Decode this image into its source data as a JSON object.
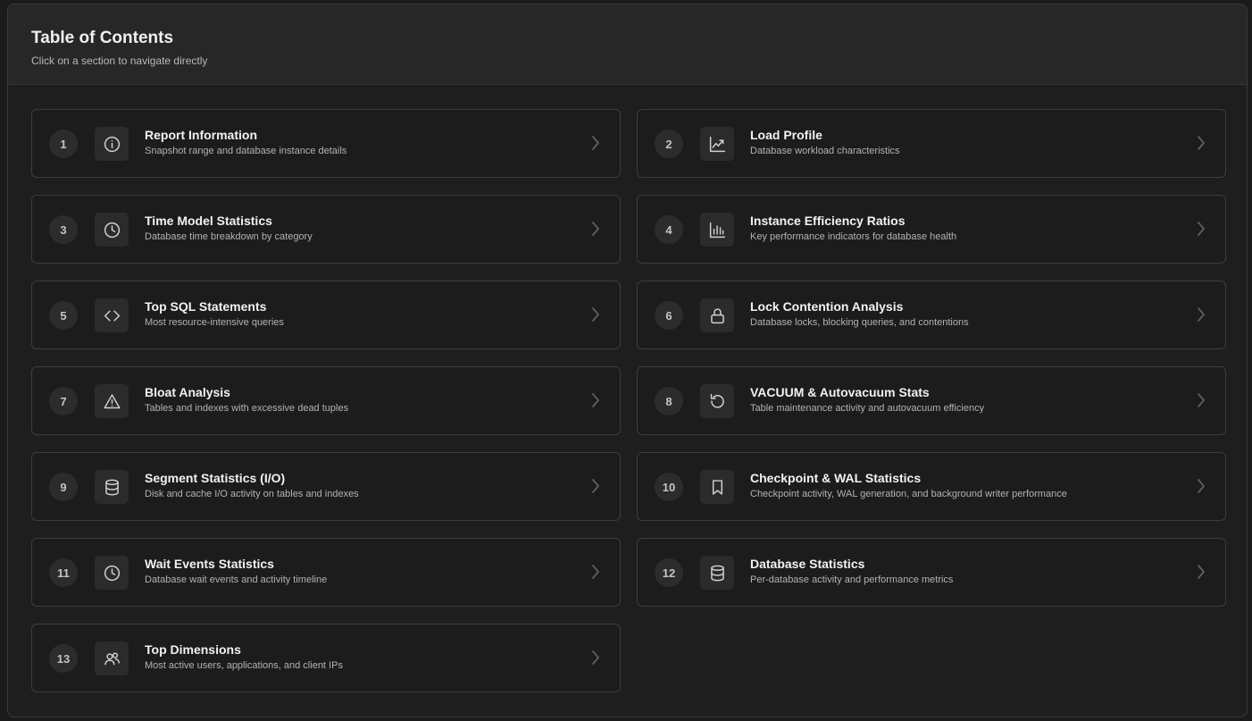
{
  "header": {
    "title": "Table of Contents",
    "subtitle": "Click on a section to navigate directly"
  },
  "sections": [
    {
      "number": "1",
      "title": "Report Information",
      "description": "Snapshot range and database instance details",
      "icon": "info-icon"
    },
    {
      "number": "2",
      "title": "Load Profile",
      "description": "Database workload characteristics",
      "icon": "trend-chart-icon"
    },
    {
      "number": "3",
      "title": "Time Model Statistics",
      "description": "Database time breakdown by category",
      "icon": "clock-icon"
    },
    {
      "number": "4",
      "title": "Instance Efficiency Ratios",
      "description": "Key performance indicators for database health",
      "icon": "bar-chart-icon"
    },
    {
      "number": "5",
      "title": "Top SQL Statements",
      "description": "Most resource-intensive queries",
      "icon": "code-icon"
    },
    {
      "number": "6",
      "title": "Lock Contention Analysis",
      "description": "Database locks, blocking queries, and contentions",
      "icon": "lock-icon"
    },
    {
      "number": "7",
      "title": "Bloat Analysis",
      "description": "Tables and indexes with excessive dead tuples",
      "icon": "warning-icon"
    },
    {
      "number": "8",
      "title": "VACUUM & Autovacuum Stats",
      "description": "Table maintenance activity and autovacuum efficiency",
      "icon": "rotate-icon"
    },
    {
      "number": "9",
      "title": "Segment Statistics (I/O)",
      "description": "Disk and cache I/O activity on tables and indexes",
      "icon": "database-icon"
    },
    {
      "number": "10",
      "title": "Checkpoint & WAL Statistics",
      "description": "Checkpoint activity, WAL generation, and background writer performance",
      "icon": "bookmark-icon"
    },
    {
      "number": "11",
      "title": "Wait Events Statistics",
      "description": "Database wait events and activity timeline",
      "icon": "clock-icon"
    },
    {
      "number": "12",
      "title": "Database Statistics",
      "description": "Per-database activity and performance metrics",
      "icon": "database-icon"
    },
    {
      "number": "13",
      "title": "Top Dimensions",
      "description": "Most active users, applications, and client IPs",
      "icon": "users-icon"
    }
  ]
}
